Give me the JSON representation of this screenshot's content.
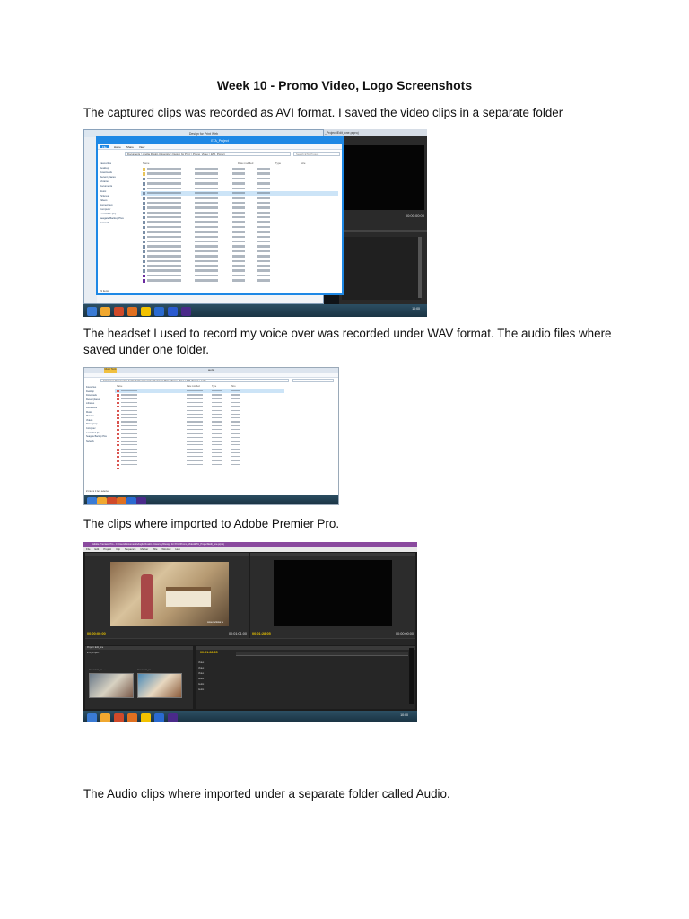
{
  "document": {
    "title": "Week 10 - Promo Video, Logo Screenshots",
    "paragraphs": [
      "The captured clips was recorded as AVI format. I saved the video clips in a separate folder",
      "The headset I used to record my voice over was recorded under WAV format. The audio files where saved under one folder.",
      "The clips where imported to Adobe Premier Pro.",
      "The Audio clips where imported under a separate folder called Audio."
    ]
  },
  "screenshots": {
    "explorer_video": {
      "window_title": "ETA_Project",
      "back_window_title": "Design for Print Web",
      "premiere_title": "_Project\\Edit_one.prproj",
      "address": "Documents > Anglia Ruskin University > Design for Print > Promo_Video > ETA_Project",
      "search_placeholder": "Search ETA_Project",
      "menu": [
        "File",
        "Home",
        "Share",
        "View"
      ],
      "columns": [
        "Name",
        "Date modified",
        "Type",
        "Size"
      ],
      "nav": [
        "Favourites",
        "Desktop",
        "Downloads",
        "Recent places",
        "Libraries",
        "Documents",
        "Music",
        "Pictures",
        "Videos",
        "Homegroup",
        "Computer",
        "Local Disk (C:)",
        "Seagate Backup Plus",
        "Network"
      ],
      "status": "21 items",
      "timecode": "00:00:00:00",
      "clock": "10:00"
    },
    "explorer_audio": {
      "window_title": "audio",
      "ribbon_tab": "Music Tools",
      "address": "Computer > Documents > Anglia Ruskin University > Design for Print > Promo_Video > ETA_Project > audio",
      "columns": [
        "Name",
        "Date modified",
        "Type",
        "Size"
      ],
      "status": "21 items    1 item selected"
    },
    "premiere": {
      "window_title": "Adobe Premiere Pro - C:\\Users\\Documents\\Anglia Ruskin University\\Design for Print\\Promo_Video\\ETA_Project\\Edit_one.prproj",
      "menu": [
        "File",
        "Edit",
        "Project",
        "Clip",
        "Sequence",
        "Marker",
        "Title",
        "Window",
        "Help"
      ],
      "source_timecode": "00:00:00:00",
      "program_timecode": "00:01:28:05",
      "mid_timecode": "00:01:01:00",
      "end_timecode": "00:00:00:00",
      "timeline_timecode": "00:01:28:05",
      "tracks": [
        "Video 3",
        "Video 2",
        "Video 1",
        "Audio 1",
        "Audio 2",
        "Audio 3"
      ],
      "project_label": "Project: Edit_one",
      "bin_label": "ETA_Project",
      "clip_labels": [
        "29-04-2014_10.avi",
        "29-04-2014_11.avi"
      ],
      "watermark": "www.rockstar.tv",
      "clock": "10:00"
    }
  },
  "colors": {
    "taskbar": "#1f3b4d",
    "explorer_blue": "#1e88e5",
    "premiere_panel": "#2b2b2b",
    "premiere_dark": "#1a1a1a",
    "folder_yellow": "#e8c45a",
    "audio_red": "#d9534f",
    "timecode_blue": "#5aa0ff",
    "timecode_yellow": "#e8c200"
  }
}
